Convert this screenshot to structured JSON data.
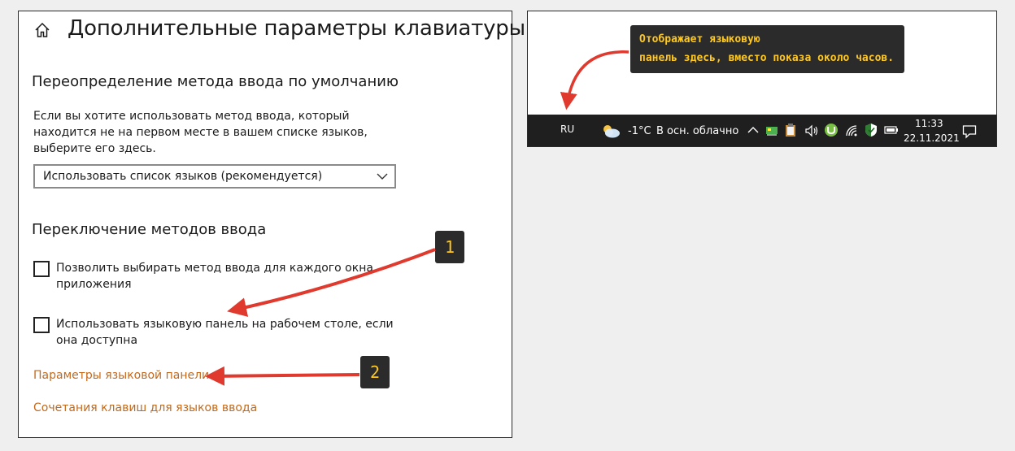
{
  "settings": {
    "title": "Дополнительные параметры клавиатуры",
    "override_section": {
      "heading": "Переопределение метода ввода по умолчанию",
      "description": "Если вы хотите использовать метод ввода, который находится не на первом месте в вашем списке языков, выберите его здесь.",
      "dropdown_value": "Использовать список языков (рекомендуется)"
    },
    "switch_section": {
      "heading": "Переключение методов ввода",
      "checkbox_per_window": {
        "label": "Позволить выбирать метод ввода для каждого окна приложения",
        "checked": false
      },
      "checkbox_language_bar": {
        "label": "Использовать языковую панель на рабочем столе, если она доступна",
        "checked": false
      }
    },
    "links": {
      "language_bar_options": "Параметры языковой панели",
      "hotkeys": "Сочетания клавиш для языков ввода"
    }
  },
  "taskbar_preview": {
    "tooltip_line1": "Отображает языковую",
    "tooltip_line2": "панель здесь, вместо показа около часов.",
    "language": "RU",
    "weather_temp": "-1°C",
    "weather_desc": "В осн. облачно",
    "clock_time": "11:33",
    "clock_date": "22.11.2021",
    "tray_icons": [
      "chevron-up-icon",
      "network-card-icon",
      "clipboard-icon",
      "speaker-icon",
      "utorrent-icon",
      "wifi-icon",
      "shield-icon",
      "battery-icon"
    ]
  },
  "badges": {
    "first": "1",
    "second": "2"
  },
  "colors": {
    "link": "#c4691b",
    "annotation_arrow": "#e03a2f",
    "badge_text": "#ffc81f",
    "taskbar": "#1f1f1f"
  }
}
